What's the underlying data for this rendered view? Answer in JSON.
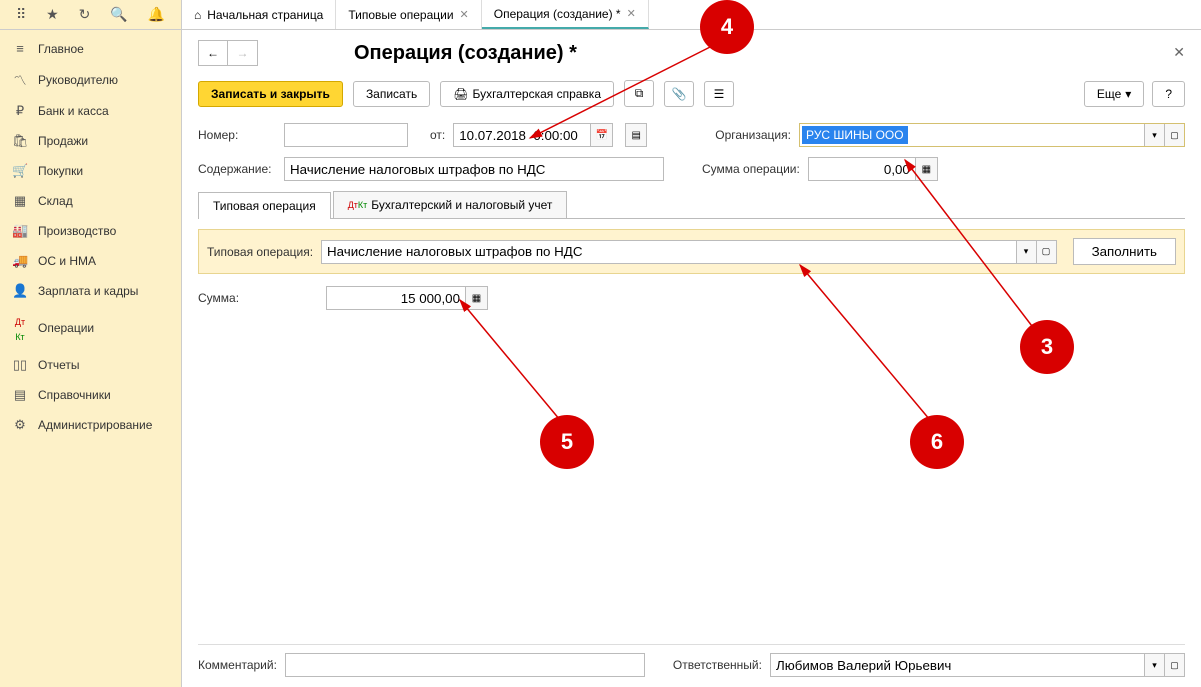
{
  "topbar": {
    "tabs": [
      {
        "label": "Начальная страница"
      },
      {
        "label": "Типовые операции"
      },
      {
        "label": "Операция (создание) *"
      }
    ]
  },
  "sidebar": {
    "items": [
      {
        "label": "Главное"
      },
      {
        "label": "Руководителю"
      },
      {
        "label": "Банк и касса"
      },
      {
        "label": "Продажи"
      },
      {
        "label": "Покупки"
      },
      {
        "label": "Склад"
      },
      {
        "label": "Производство"
      },
      {
        "label": "ОС и НМА"
      },
      {
        "label": "Зарплата и кадры"
      },
      {
        "label": "Операции"
      },
      {
        "label": "Отчеты"
      },
      {
        "label": "Справочники"
      },
      {
        "label": "Администрирование"
      }
    ]
  },
  "title": "Операция (создание) *",
  "toolbar": {
    "save_close": "Записать и закрыть",
    "save": "Записать",
    "report": "Бухгалтерская справка",
    "more": "Еще",
    "help": "?"
  },
  "form": {
    "number_label": "Номер:",
    "number_value": "",
    "from_label": "от:",
    "date_value": "10.07.2018  0:00:00",
    "org_label": "Организация:",
    "org_value": "РУС ШИНЫ ООО",
    "content_label": "Содержание:",
    "content_value": "Начисление налоговых штрафов по НДС",
    "sum_op_label": "Сумма операции:",
    "sum_op_value": "0,00"
  },
  "tabs": {
    "t1": "Типовая операция",
    "t2": "Бухгалтерский и налоговый учет"
  },
  "typical": {
    "label": "Типовая операция:",
    "value": "Начисление налоговых штрафов по НДС",
    "fill": "Заполнить"
  },
  "sum": {
    "label": "Сумма:",
    "value": "15 000,00"
  },
  "bottom": {
    "comment_label": "Комментарий:",
    "comment_value": "",
    "resp_label": "Ответственный:",
    "resp_value": "Любимов Валерий Юрьевич"
  },
  "callouts": {
    "c3": "3",
    "c4": "4",
    "c5": "5",
    "c6": "6"
  }
}
